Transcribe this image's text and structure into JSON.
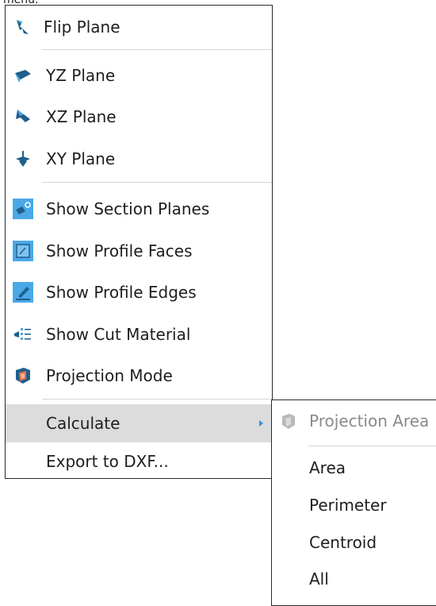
{
  "caption": "menu.",
  "menu": {
    "items": [
      {
        "label": "Flip Plane",
        "icon": "flip-plane-icon"
      },
      {
        "label": "YZ Plane",
        "icon": "yz-plane-icon"
      },
      {
        "label": "XZ Plane",
        "icon": "xz-plane-icon"
      },
      {
        "label": "XY Plane",
        "icon": "xy-plane-icon"
      },
      {
        "label": "Show Section Planes",
        "icon": "show-section-planes-icon",
        "checked": true
      },
      {
        "label": "Show Profile Faces",
        "icon": "show-profile-faces-icon",
        "checked": true
      },
      {
        "label": "Show Profile Edges",
        "icon": "show-profile-edges-icon",
        "checked": true
      },
      {
        "label": "Show Cut Material",
        "icon": "show-cut-material-icon"
      },
      {
        "label": "Projection Mode",
        "icon": "projection-mode-icon"
      },
      {
        "label": "Calculate",
        "has_submenu": true,
        "highlighted": true
      },
      {
        "label": "Export to DXF..."
      }
    ]
  },
  "submenu": {
    "items": [
      {
        "label": "Projection Area",
        "icon": "projection-area-icon",
        "disabled": true
      },
      {
        "label": "Area"
      },
      {
        "label": "Perimeter"
      },
      {
        "label": "Centroid"
      },
      {
        "label": "All"
      }
    ]
  },
  "colors": {
    "accent": "#3b90d6",
    "icon_dark": "#1f5f8b",
    "checked_bg": "#4aa8e8",
    "highlight": "#dcdcdc",
    "disabled_text": "#8a8a8a"
  }
}
